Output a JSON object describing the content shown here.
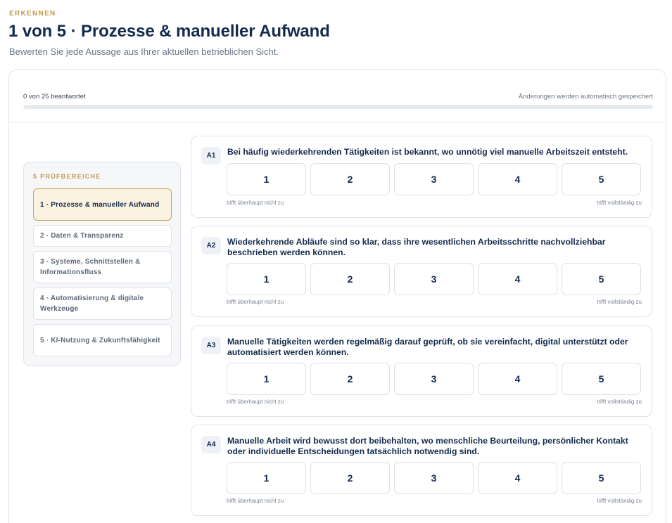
{
  "header": {
    "eyebrow": "ERKENNEN",
    "title": "1 von 5 · Prozesse & manueller Aufwand",
    "subtitle": "Bewerten Sie jede Aussage aus Ihrer aktuellen betrieblichen Sicht."
  },
  "progress": {
    "count_label": "0 von 25 beantwortet",
    "save_note": "Änderungen werden automatisch gespeichert",
    "answered": 0,
    "total": 25,
    "fill_color": "#c19a4c"
  },
  "sidebar": {
    "heading": "5 PRÜFBEREICHE",
    "items": [
      {
        "label": "1 · Prozesse & manueller Aufwand",
        "active": true
      },
      {
        "label": "2 · Daten & Transparenz",
        "active": false
      },
      {
        "label": "3 · Systeme, Schnittstellen & Informationsfluss",
        "active": false
      },
      {
        "label": "4 · Automatisierung & digitale Werkzeuge",
        "active": false
      },
      {
        "label": "5 · KI-Nutzung & Zukunftsfähigkeit",
        "active": false
      }
    ]
  },
  "scale": {
    "options": [
      "1",
      "2",
      "3",
      "4",
      "5"
    ],
    "min_label": "trifft überhaupt nicht zu",
    "max_label": "trifft vollständig zu"
  },
  "questions": [
    {
      "id": "A1",
      "text": "Bei häufig wiederkehrenden Tätigkeiten ist bekannt, wo unnötig viel manuelle Arbeitszeit entsteht."
    },
    {
      "id": "A2",
      "text": "Wiederkehrende Abläufe sind so klar, dass ihre wesentlichen Arbeitsschritte nachvollziehbar beschrieben werden können."
    },
    {
      "id": "A3",
      "text": "Manuelle Tätigkeiten werden regelmäßig darauf geprüft, ob sie vereinfacht, digital unterstützt oder automatisiert werden können."
    },
    {
      "id": "A4",
      "text": "Manuelle Arbeit wird bewusst dort beibehalten, wo menschliche Beurteilung, persönlicher Kontakt oder individuelle Entscheidungen tatsächlich notwendig sind."
    }
  ]
}
